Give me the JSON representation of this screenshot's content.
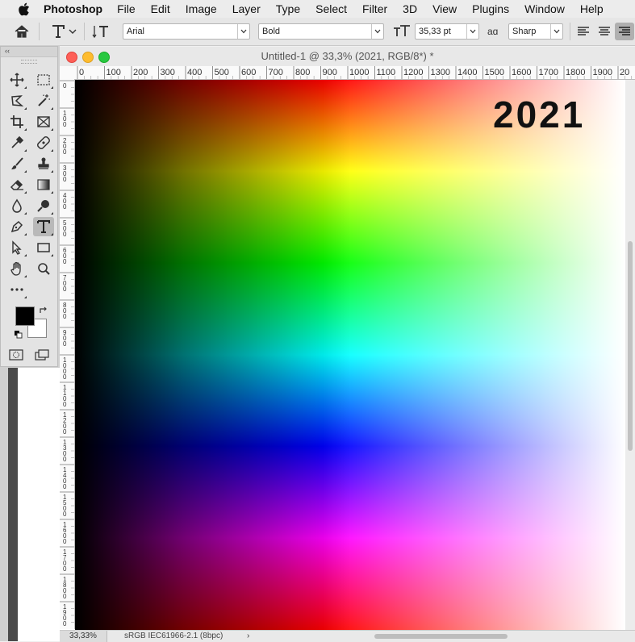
{
  "menubar": {
    "app_name": "Photoshop",
    "items": [
      "File",
      "Edit",
      "Image",
      "Layer",
      "Type",
      "Select",
      "Filter",
      "3D",
      "View",
      "Plugins",
      "Window",
      "Help"
    ]
  },
  "options_bar": {
    "font_family": "Arial",
    "font_style": "Bold",
    "font_size": "35,33 pt",
    "aa_icon_label": "aɑ",
    "antialias": "Sharp"
  },
  "tools_panel": {
    "collapse_label": "‹‹",
    "active_tool": "type-tool",
    "foreground_color": "#000000",
    "background_color": "#ffffff"
  },
  "document": {
    "title": "Untitled-1 @ 33,3% (2021, RGB/8*) *",
    "canvas_text": "2021",
    "zoom": "33,33%",
    "color_profile": "sRGB IEC61966-2.1 (8bpc)",
    "status_arrow": "›",
    "ruler_h_labels": [
      "0",
      "100",
      "200",
      "300",
      "400",
      "500",
      "600",
      "700",
      "800",
      "900",
      "1000",
      "1100",
      "1200",
      "1300",
      "1400",
      "1500",
      "1600",
      "1700",
      "1800",
      "1900",
      "20"
    ],
    "ruler_v_labels": [
      "0",
      "100",
      "200",
      "300",
      "400",
      "500",
      "600",
      "700",
      "800",
      "900",
      "1000",
      "1100",
      "1200",
      "1300",
      "1400",
      "1500",
      "1600",
      "1700",
      "1800",
      "1900"
    ]
  },
  "colors": {
    "close": "#fe5f57",
    "minimize": "#febc2e",
    "zoom": "#28c840"
  }
}
